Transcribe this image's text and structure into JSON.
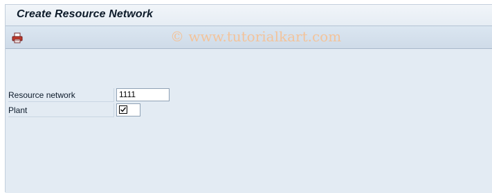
{
  "window": {
    "title": "Create Resource Network"
  },
  "toolbar": {
    "print_icon": "printer-icon"
  },
  "watermark": {
    "text": "© www.tutorialkart.com"
  },
  "form": {
    "resource_network": {
      "label": "Resource network",
      "value": "1111"
    },
    "plant": {
      "label": "Plant",
      "value": "",
      "icon": "required-entry-check-icon"
    }
  }
}
